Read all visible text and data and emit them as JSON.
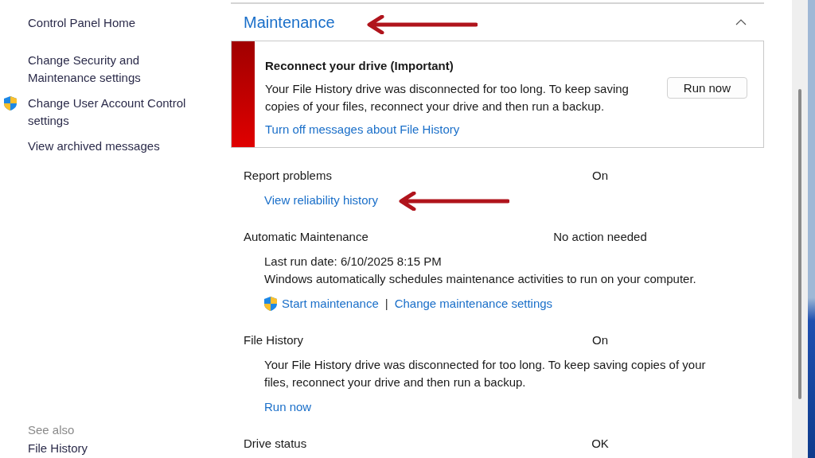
{
  "sidebar": {
    "home": "Control Panel Home",
    "items": [
      {
        "label": "Change Security and Maintenance settings",
        "shield": false
      },
      {
        "label": "Change User Account Control settings",
        "shield": true
      },
      {
        "label": "View archived messages",
        "shield": false
      }
    ],
    "see_also": {
      "heading": "See also",
      "items": [
        "File History"
      ]
    }
  },
  "section": {
    "title": "Maintenance",
    "expanded": true,
    "alert": {
      "title": "Reconnect your drive  (Important)",
      "message": "Your File History drive was disconnected for too long. To keep saving copies of your files, reconnect your drive and then run a backup.",
      "link": "Turn off messages about File History",
      "button": "Run now"
    },
    "rows": [
      {
        "label": "Report problems",
        "value": "On",
        "details": [
          {
            "kind": "link",
            "text": "View reliability history"
          }
        ]
      },
      {
        "label": "Automatic Maintenance",
        "value": "No action needed",
        "details": [
          {
            "kind": "text",
            "text": "Last run date: 6/10/2025 8:15 PM"
          },
          {
            "kind": "text",
            "text": "Windows automatically schedules maintenance activities to run on your computer."
          },
          {
            "kind": "actions",
            "separator": "|",
            "items": [
              {
                "text": "Start maintenance",
                "shield": true
              },
              {
                "text": "Change maintenance settings",
                "shield": false
              }
            ]
          }
        ]
      },
      {
        "label": "File History",
        "value": "On",
        "details": [
          {
            "kind": "text",
            "text": "Your File History drive was disconnected for too long. To keep saving copies of your files, reconnect your drive and then run a backup."
          },
          {
            "kind": "link",
            "text": "Run now"
          }
        ]
      },
      {
        "label": "Drive status",
        "value": "OK",
        "details": []
      }
    ]
  }
}
